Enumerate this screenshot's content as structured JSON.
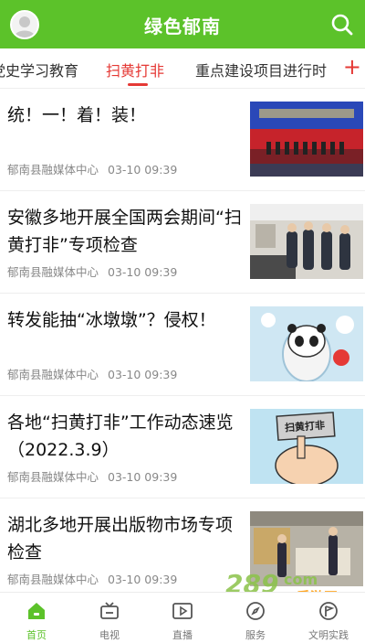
{
  "header": {
    "title": "绿色郁南"
  },
  "tabs": [
    {
      "label": "党史学习教育"
    },
    {
      "label": "扫黄打非"
    },
    {
      "label": "重点建设项目进行时"
    }
  ],
  "tab_add_symbol": "+",
  "news": [
    {
      "title": "统！一！着！装！",
      "source": "郁南县融媒体中心",
      "time": "03-10 09:39"
    },
    {
      "title": "安徽多地开展全国两会期间“扫黄打非”专项检查",
      "source": "郁南县融媒体中心",
      "time": "03-10 09:39"
    },
    {
      "title": "转发能抽“冰墩墩”？侵权！",
      "source": "郁南县融媒体中心",
      "time": "03-10 09:39"
    },
    {
      "title": "各地“扫黄打非”工作动态速览（2022.3.9）",
      "source": "郁南县融媒体中心",
      "time": "03-10 09:39"
    },
    {
      "title": "湖北多地开展出版物市场专项检查",
      "source": "郁南县融媒体中心",
      "time": "03-10 09:39"
    }
  ],
  "thumb_texts": {
    "item4_sign": "扫黄打非"
  },
  "bottom_nav": [
    {
      "label": "首页",
      "icon": "home-icon"
    },
    {
      "label": "电视",
      "icon": "tv-icon"
    },
    {
      "label": "直播",
      "icon": "live-icon"
    },
    {
      "label": "服务",
      "icon": "compass-icon"
    },
    {
      "label": "文明实践",
      "icon": "flag-icon"
    }
  ],
  "watermark": {
    "number": "289",
    "suffix": "com",
    "text": "手游网"
  },
  "colors": {
    "brand_green": "#5cc22a",
    "active_red": "#e53935"
  }
}
